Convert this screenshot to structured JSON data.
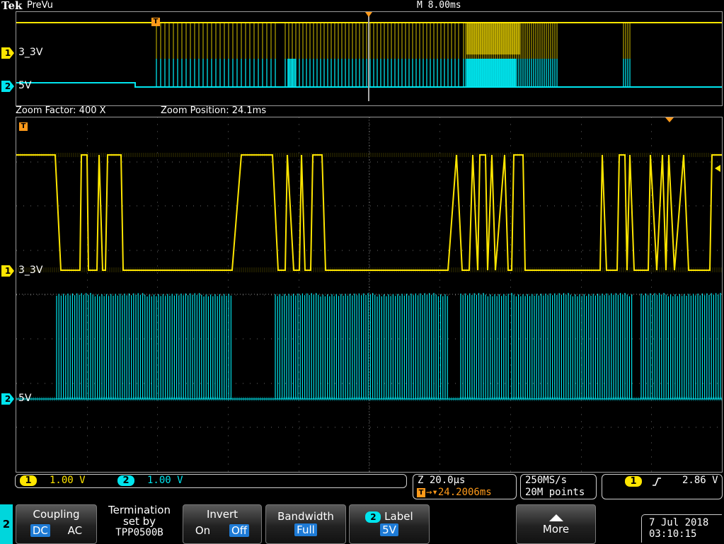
{
  "header": {
    "brand": "Tek",
    "mode": "PreVu",
    "timebase": "M 8.00ms"
  },
  "overview": {
    "ch1_label": "3_3V",
    "ch2_label": "5V",
    "trigger_marker": "T"
  },
  "zoom": {
    "factor_label": "Zoom Factor: 400 X",
    "position_label": "Zoom Position: 24.1ms"
  },
  "main": {
    "ch1_label": "3_3V",
    "ch2_label": "5V",
    "trigger_marker": "T"
  },
  "channels": [
    {
      "num": "1",
      "scale": "1.00 V",
      "color": "#ffe600",
      "label": "3_3V"
    },
    {
      "num": "2",
      "scale": "1.00 V",
      "color": "#00e5ee",
      "label": "5V"
    }
  ],
  "horizontal": {
    "zoom_scale": "Z 20.0µs",
    "trigger_pos": "→▾24.2006ms"
  },
  "acquisition": {
    "sample_rate": "250MS/s",
    "record_length": "20M points"
  },
  "trigger": {
    "source": "1",
    "slope_icon": "rising-edge-icon",
    "level": "2.86 V"
  },
  "menu": {
    "channel_tab": "2",
    "coupling": {
      "title": "Coupling",
      "options": [
        "DC",
        "AC"
      ],
      "selected": "DC"
    },
    "termination": {
      "line1": "Termination",
      "line2": "set by",
      "line3": "TPP0500B"
    },
    "invert": {
      "title": "Invert",
      "options": [
        "On",
        "Off"
      ],
      "selected": "Off"
    },
    "bandwidth": {
      "title": "Bandwidth",
      "value": "Full"
    },
    "label": {
      "chan": "2",
      "title": "Label",
      "value": "5V"
    },
    "more": {
      "title": "More"
    }
  },
  "datetime": {
    "date": "7 Jul  2018",
    "time": "03:10:15"
  },
  "colors": {
    "ch1": "#ffe600",
    "ch2": "#00e5ee",
    "trigger": "#ff9a1a",
    "grid": "#6a6a6a"
  }
}
